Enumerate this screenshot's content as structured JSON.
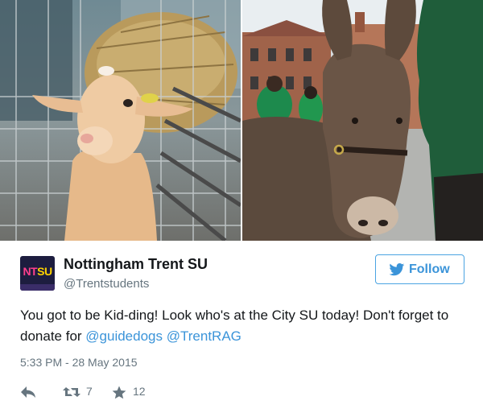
{
  "account": {
    "avatar_text_nt": "NT",
    "avatar_text_su": "SU",
    "display_name": "Nottingham Trent SU",
    "handle": "@Trentstudents"
  },
  "follow": {
    "label": "Follow"
  },
  "tweet": {
    "text_part1": "You got to be Kid-ding! Look who's at the City SU today! Don't forget to donate for ",
    "mention1": "@guidedogs",
    "text_sep": " ",
    "mention2": "@TrentRAG",
    "timestamp": "5:33 PM - 28 May 2015"
  },
  "actions": {
    "retweet_count": "7",
    "favorite_count": "12"
  },
  "icons": {
    "follow": "twitter-bird-icon",
    "reply": "reply-arrow-icon",
    "retweet": "retweet-icon",
    "favorite": "star-icon"
  },
  "colors": {
    "link": "#3b94d9",
    "secondary_text": "#66757f",
    "follow_border": "#4ba4e2",
    "avatar_bg": "#1d1d3f"
  }
}
